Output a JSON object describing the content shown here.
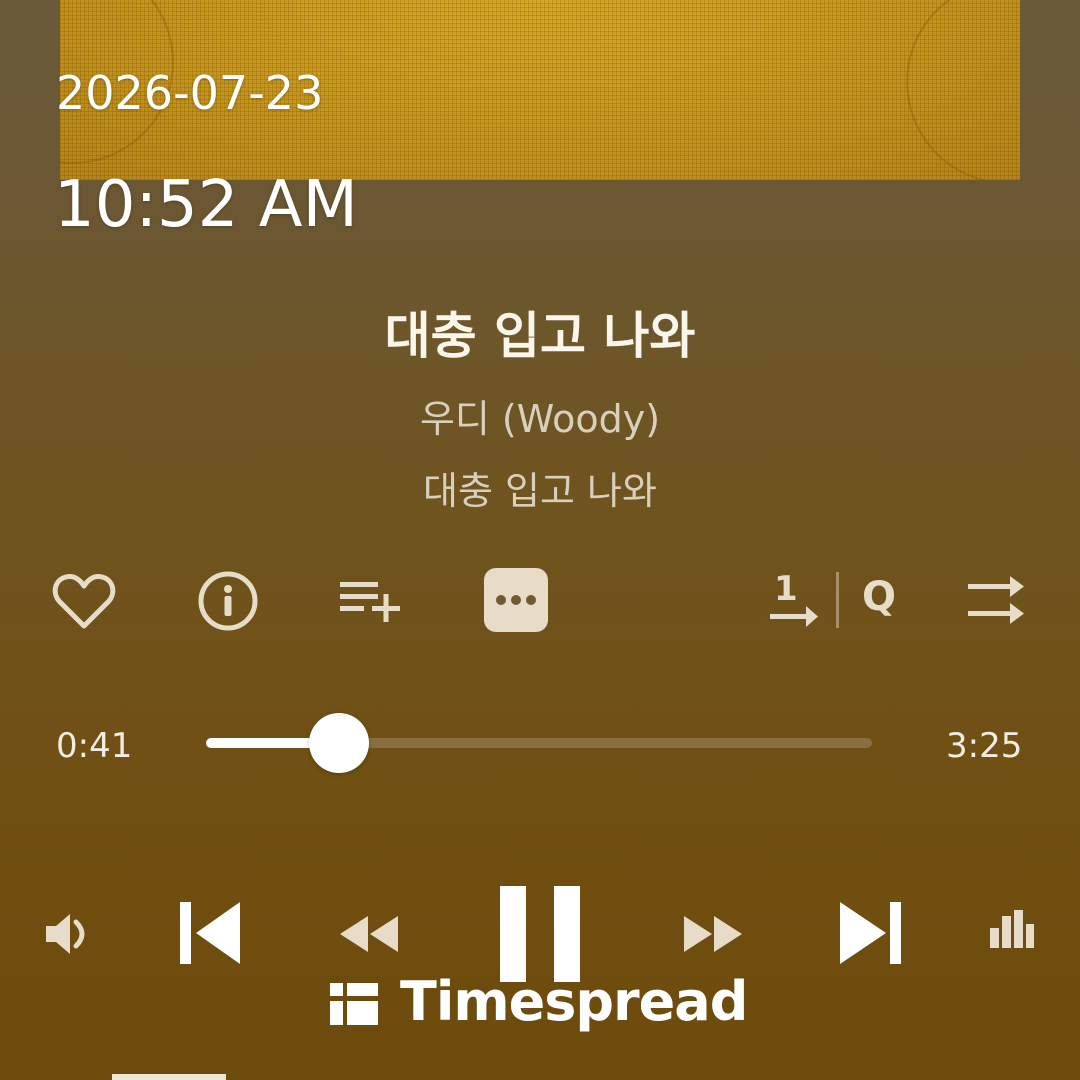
{
  "overlay": {
    "date": "2026-07-23",
    "time": "10:52 AM"
  },
  "track": {
    "title": "대충 입고 나와",
    "artist": "우디 (Woody)",
    "album": "대충 입고 나와"
  },
  "actions": {
    "like_icon": "heart-outline-icon",
    "info_icon": "info-circle-icon",
    "add_to_playlist_icon": "playlist-add-icon",
    "more_icon": "more-dots-icon",
    "repeat_one_icon": "repeat-one-icon",
    "quality_label": "Q",
    "shuffle_icon": "shuffle-icon"
  },
  "progress": {
    "current": "0:41",
    "total": "3:25",
    "fraction": 0.2
  },
  "controls": {
    "volume_icon": "volume-icon",
    "previous_icon": "skip-previous-icon",
    "rewind_icon": "rewind-icon",
    "pause_icon": "pause-icon",
    "forward_icon": "fast-forward-icon",
    "next_icon": "skip-next-icon",
    "equalizer_icon": "equalizer-icon"
  },
  "watermark": {
    "text": "Timespread"
  },
  "colors": {
    "background_top": "#6a5a3a",
    "background_bottom": "#6d4b0c",
    "album_art": "#c9981c",
    "icon_tint": "#e6dcc8",
    "text_primary": "#fbf6ec",
    "text_secondary": "#d9cfbd"
  }
}
